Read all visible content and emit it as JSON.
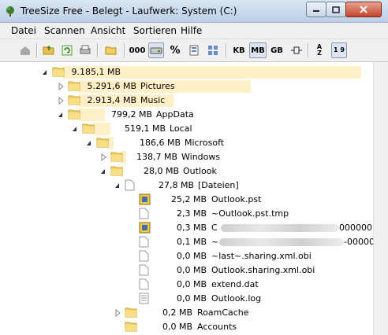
{
  "window": {
    "title": "TreeSize Free - Belegt - Laufwerk: System (C:)"
  },
  "menu": {
    "items": [
      "Datei",
      "Scannen",
      "Ansicht",
      "Sortieren",
      "Hilfe"
    ]
  },
  "toolbar": {
    "kb": "KB",
    "mb": "MB",
    "gb": "GB",
    "percent": "%",
    "ooo": "000",
    "sort_az": "A Z",
    "sort_19": "1 9"
  },
  "tree": {
    "rows": [
      {
        "size": "9.185,1 MB",
        "name": "",
        "fill": 1.0
      },
      {
        "size": "5.291,6 MB",
        "name": "Pictures",
        "fill": 0.576
      },
      {
        "size": "2.913,4 MB",
        "name": "Music",
        "fill": 0.317
      },
      {
        "size": "799,2 MB",
        "name": "AppData",
        "fill": 0.087
      },
      {
        "size": "519,1 MB",
        "name": "Local",
        "fill": 0.057
      },
      {
        "size": "186,6 MB",
        "name": "Microsoft",
        "fill": 0.02
      },
      {
        "size": "138,7 MB",
        "name": "Windows",
        "fill": 0.015
      },
      {
        "size": "28,0 MB",
        "name": "Outlook",
        "fill": 0.003
      },
      {
        "size": "27,8 MB",
        "name": "[Dateien]"
      },
      {
        "size": "25,2 MB",
        "name": "Outlook.pst"
      },
      {
        "size": "2,3 MB",
        "name": "~Outlook.pst.tmp"
      },
      {
        "size": "0,3 MB",
        "name": "C",
        "tail": "000000"
      },
      {
        "size": "0,1 MB",
        "name": "~",
        "tail": "-000000"
      },
      {
        "size": "0,0 MB",
        "name": "~last~.sharing.xml.obi"
      },
      {
        "size": "0,0 MB",
        "name": "Outlook.sharing.xml.obi"
      },
      {
        "size": "0,0 MB",
        "name": "extend.dat"
      },
      {
        "size": "0,0 MB",
        "name": "Outlook.log"
      },
      {
        "size": "0,2 MB",
        "name": "RoamCache"
      },
      {
        "size": "0,0 MB",
        "name": "Accounts"
      }
    ]
  }
}
